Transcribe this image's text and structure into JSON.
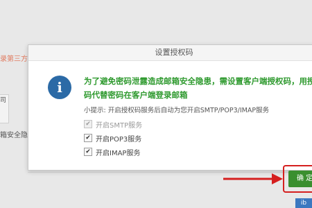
{
  "background": {
    "login_link": "录第三方",
    "row_label": "司",
    "security_text": "箱安全隐"
  },
  "dialog": {
    "title": "设置授权码",
    "warning": "为了避免密码泄露造成邮箱安全隐患，需设置客户端授权码，用授权码代替密码在客户端登录邮箱",
    "hint": "小提示: 开启授权码服务后自动为您开启SMTP/POP3/IMAP服务",
    "options": [
      {
        "label": "开启SMTP服务",
        "checked": true,
        "disabled": true
      },
      {
        "label": "开启POP3服务",
        "checked": true,
        "disabled": false
      },
      {
        "label": "开启IMAP服务",
        "checked": true,
        "disabled": false
      }
    ],
    "confirm_label": "确 定"
  },
  "colors": {
    "warning_green": "#2f9a2f",
    "info_blue": "#2b6aa6",
    "confirm_green": "#3a8f2f",
    "annotation_red": "#d51f1f"
  },
  "icons": {
    "info": "info-icon",
    "checkbox": "checkmark-icon",
    "arrow": "arrow-right-icon"
  },
  "corner_mark": "ib"
}
